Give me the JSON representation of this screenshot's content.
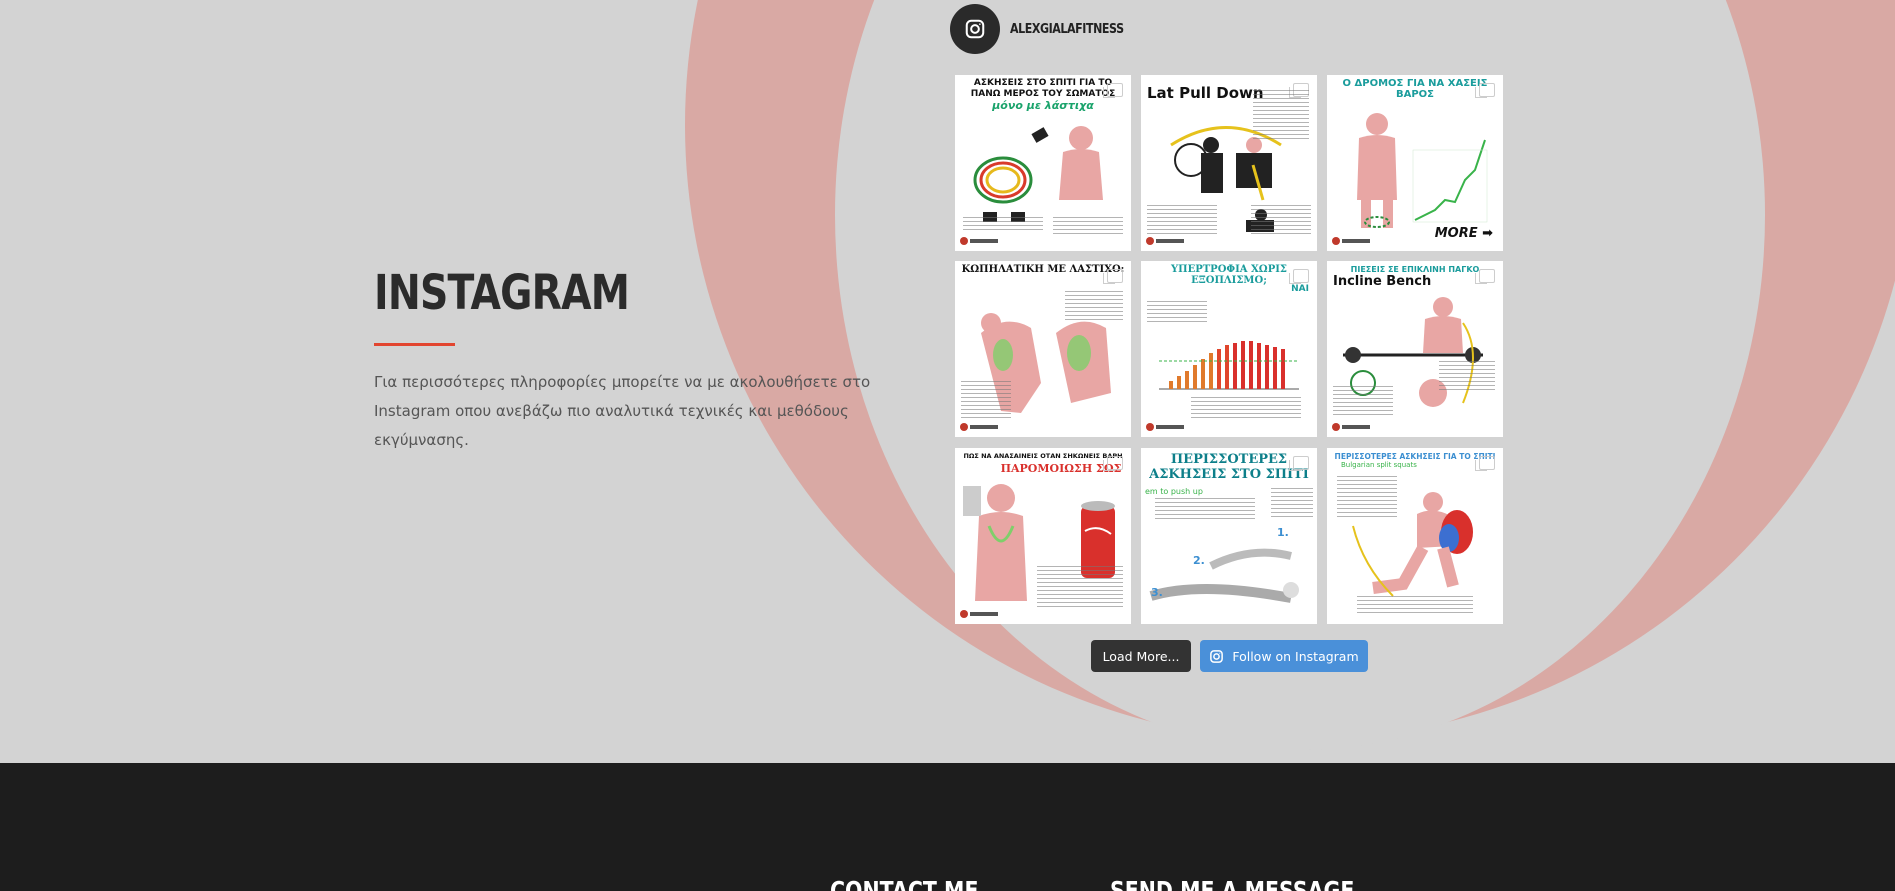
{
  "instagram": {
    "heading": "INSTAGRAM",
    "description": "Για περισσότερες πληροφορίες μπορείτε να με ακολουθήσετε στο Instagram οπου ανεβάζω πιο αναλυτικά τεχνικές και μεθόδους εκγύμνασης."
  },
  "profile": {
    "username": "ALEXGIALAFITNESS"
  },
  "posts": [
    {
      "title": "ΑΣΚΗΣΕΙΣ ΣΤΟ ΣΠΙΤΙ ΓΙΑ ΤΟ ΠΑΝΩ ΜΕΡΟΣ ΤΟΥ ΣΩΜΑΤΟΣ",
      "subtitle": "μόνο με λάστιχα"
    },
    {
      "title": "Lat Pull Down"
    },
    {
      "title": "Ο ΔΡΟΜΟΣ ΓΙΑ ΝΑ ΧΑΣΕΙΣ ΒΑΡΟΣ",
      "badge": "MORE ➡"
    },
    {
      "title": "ΚΩΠΗΛΑΤΙΚΗ ΜΕ ΛΑΣΤΙΧΟ:"
    },
    {
      "title": "ΥΠΕΡΤΡΟΦΙΑ ΧΩΡΙΣ ΕΞΟΠΛΙΣΜΟ;",
      "subtitle": "ΝΑΙ"
    },
    {
      "title": "ΠΙΕΣΕΙΣ ΣΕ ΕΠΙΚΛΙΝΗ ΠΑΓΚΟ",
      "subtitle": "Incline Bench"
    },
    {
      "title": "ΠΩΣ ΝΑ ΑΝΑΣΑΙΝΕΙΣ ΟΤΑΝ ΣΗΚΩΝΕΙΣ ΒΑΡΗ",
      "subtitle": "ΠΑΡΟΜΟΙΩΣΗ ΣΩΣ"
    },
    {
      "title": "ΠΕΡΙΣΣΟΤΕΡΕΣ ΑΣΚΗΣΕΙΣ ΣΤΟ ΣΠΙΤΙ"
    },
    {
      "title": "ΠΕΡΙΣΣΟΤΕΡΕΣ ΑΣΚΗΣΕΙΣ ΓΙΑ ΤΟ ΣΠΙΤΙ",
      "subtitle": "Bulgarian split squats"
    }
  ],
  "buttons": {
    "load_more": "Load More...",
    "follow": "Follow on Instagram"
  },
  "footer": {
    "contact_heading": "CONTACT ME",
    "message_heading": "SEND ME A MESSAGE"
  },
  "colors": {
    "accent": "#e2452f",
    "ring": "#d9a9a4",
    "follow_button": "#4a90d9",
    "load_button": "#333333",
    "footer_bg": "#1d1d1d"
  }
}
